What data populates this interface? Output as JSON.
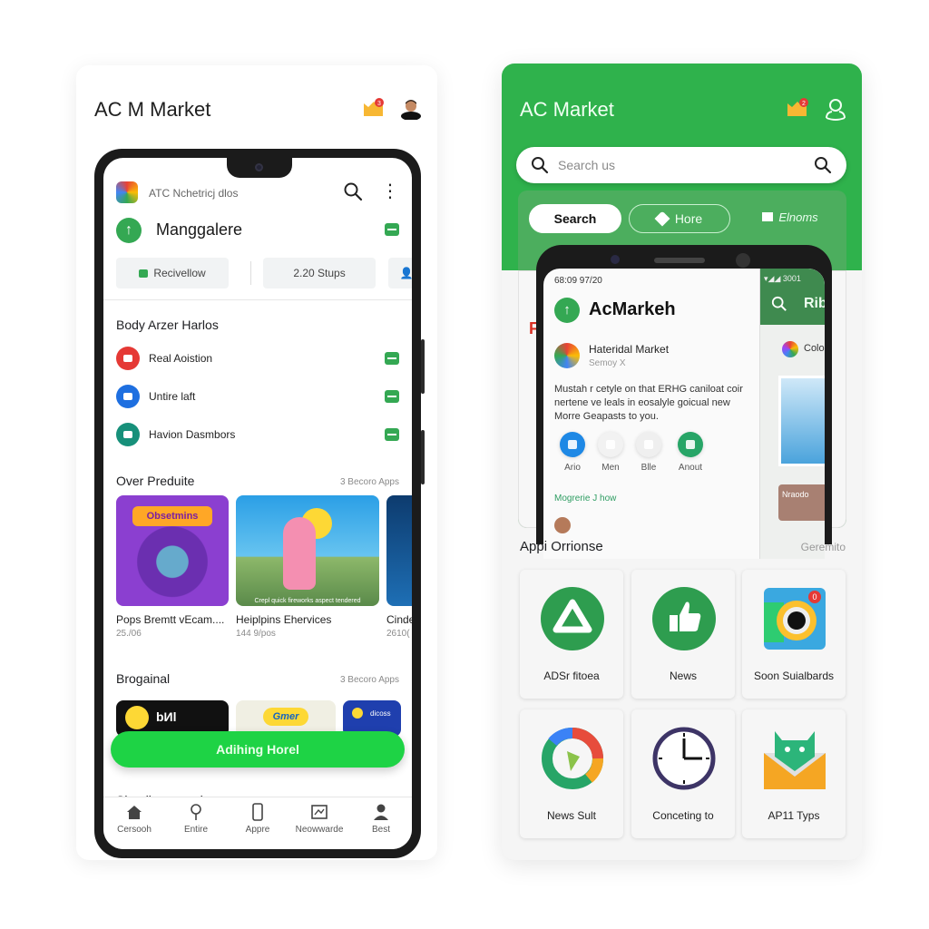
{
  "left_card": {
    "title": "AC M Market",
    "notification_count": "3",
    "phone": {
      "app_title": "ATC Nchetricj dlos",
      "brand_name": "Manggalere",
      "chips": [
        {
          "label": "Recivellow"
        },
        {
          "label": "2.20 Stups"
        }
      ],
      "section1": {
        "title": "Body Arzer Harlos",
        "items": [
          {
            "label": "Real Aoistion",
            "icon": "video-icon",
            "color": "#e53935"
          },
          {
            "label": "Untire laft",
            "icon": "image-icon",
            "color": "#1e6fe0"
          },
          {
            "label": "Havion Dasmbors",
            "icon": "cart-icon",
            "color": "#17907a"
          }
        ]
      },
      "section2": {
        "title": "Over Preduite",
        "more": "3 Becoro Apps",
        "tiles": [
          {
            "name": "Pops Bremtt vEcam....",
            "sub": "25./06",
            "art_text": "Obsetmins"
          },
          {
            "name": "Heiplpins Ehervices",
            "sub": "144 9/pos",
            "art_text": "Crepl quick fireworks aspect tendered"
          },
          {
            "name": "Cinde",
            "sub": "2610("
          }
        ]
      },
      "section3": {
        "title": "Brogainal",
        "more": "3 Becoro Apps",
        "tiles": [
          {
            "art_text": "bИl"
          },
          {
            "art_text": "Gmer"
          },
          {
            "art_text": "dicoss"
          }
        ]
      },
      "cta_label": "Adihing Horel",
      "section4_title": "Sleoding accods",
      "bottom_nav": [
        {
          "label": "Cersooh",
          "icon": "home-icon"
        },
        {
          "label": "Entire",
          "icon": "location-pin-icon"
        },
        {
          "label": "Appre",
          "icon": "phone-icon"
        },
        {
          "label": "Neowwarde",
          "icon": "image-frame-icon"
        },
        {
          "label": "Best",
          "icon": "person-icon"
        }
      ]
    }
  },
  "right_card": {
    "title": "AC Market",
    "notification_count": "2",
    "search": {
      "placeholder": "Search us"
    },
    "pills": [
      {
        "label": "Search",
        "active": true
      },
      {
        "label": "Hore",
        "icon": "heart-icon"
      },
      {
        "label": "Elnoms",
        "icon": "trophy-icon"
      }
    ],
    "partial_letter": "F",
    "phone": {
      "status_time": "68:09 97/20",
      "brand": "AcMarkeh",
      "item_name": "Hateridal Market",
      "item_sub": "Semoy X",
      "description": "Mustah r cetyle on that ERHG caniloat coir nertene ve leals in eosalyle goicual new Morre Geapasts to you.",
      "actions": [
        {
          "label": "Ario",
          "color": "#1e88e5"
        },
        {
          "label": "Men",
          "color": "#f2f2f2"
        },
        {
          "label": "Blle",
          "color": "#efefef"
        },
        {
          "label": "Anout",
          "color": "#27a567"
        }
      ],
      "link": "Mogrerie J how",
      "side": {
        "status": "3001",
        "header": "Rib",
        "item": "Colo",
        "card_text": "Nraodo"
      }
    },
    "section": {
      "title": "Appi Orrionse",
      "more": "Geremito"
    },
    "grid": [
      {
        "label": "ADSr fitoea",
        "icon": "triangle-nodes-icon"
      },
      {
        "label": "News",
        "icon": "thumbs-up-icon"
      },
      {
        "label": "Soon Suialbards",
        "icon": "camera-icon",
        "badge": "0"
      },
      {
        "label": "News Sult",
        "icon": "refresh-ring-icon"
      },
      {
        "label": "Conceting to",
        "icon": "clock-icon"
      },
      {
        "label": "AP11 Typs",
        "icon": "android-mail-icon"
      }
    ],
    "accent_color": "#2fb24c"
  }
}
